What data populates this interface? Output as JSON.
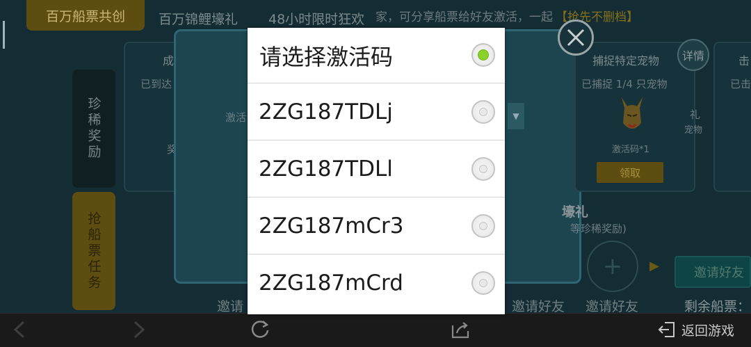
{
  "background": {
    "tabs": {
      "active": "百万船票共创",
      "second": "百万锦鲤壕礼",
      "third": "48小时限时狂欢"
    },
    "marquee": {
      "text": "家，可分享船票给好友激活，一起",
      "highlight": "【抢先不删档】"
    },
    "side_menu": {
      "rare_rewards": "珍稀奖励",
      "ticket_tasks": "抢船票任务"
    },
    "card_left": {
      "title": "成",
      "subtitle": "已到达"
    },
    "card_pet": {
      "title": "捕捉特定宠物",
      "progress": "已捕捉 1/4 只宠物",
      "reward": "激活码*1",
      "claim_label": "领取",
      "side_text_1": "礼",
      "side_text_2": "宠物"
    },
    "card_right": {
      "title": "击",
      "subtitle": "已击"
    },
    "inner_dialog_label": "激活",
    "detail_label": "详情",
    "grand_gift": {
      "title": "壕礼",
      "subtitle": "等珍稀奖励)"
    },
    "invite_label_1": "邀请",
    "invite_label_2": "邀请好友",
    "invite_label_3": "邀请好友",
    "invite_button": "邀请好友",
    "remaining_tickets": "剩余船票：",
    "left_partial": "奖",
    "plus_symbol": "+"
  },
  "bottom_bar": {
    "back_to_game": "返回游戏",
    "icons": [
      "back-arrow-icon",
      "forward-arrow-icon",
      "refresh-icon",
      "share-icon",
      "exit-icon"
    ]
  },
  "popup": {
    "title": "请选择激活码",
    "selected_index": -1,
    "options": [
      {
        "label": "2ZG187TDLj"
      },
      {
        "label": "2ZG187TDLl"
      },
      {
        "label": "2ZG187mCr3"
      },
      {
        "label": "2ZG187mCrd"
      }
    ],
    "accent_color": "#8bd12c"
  }
}
